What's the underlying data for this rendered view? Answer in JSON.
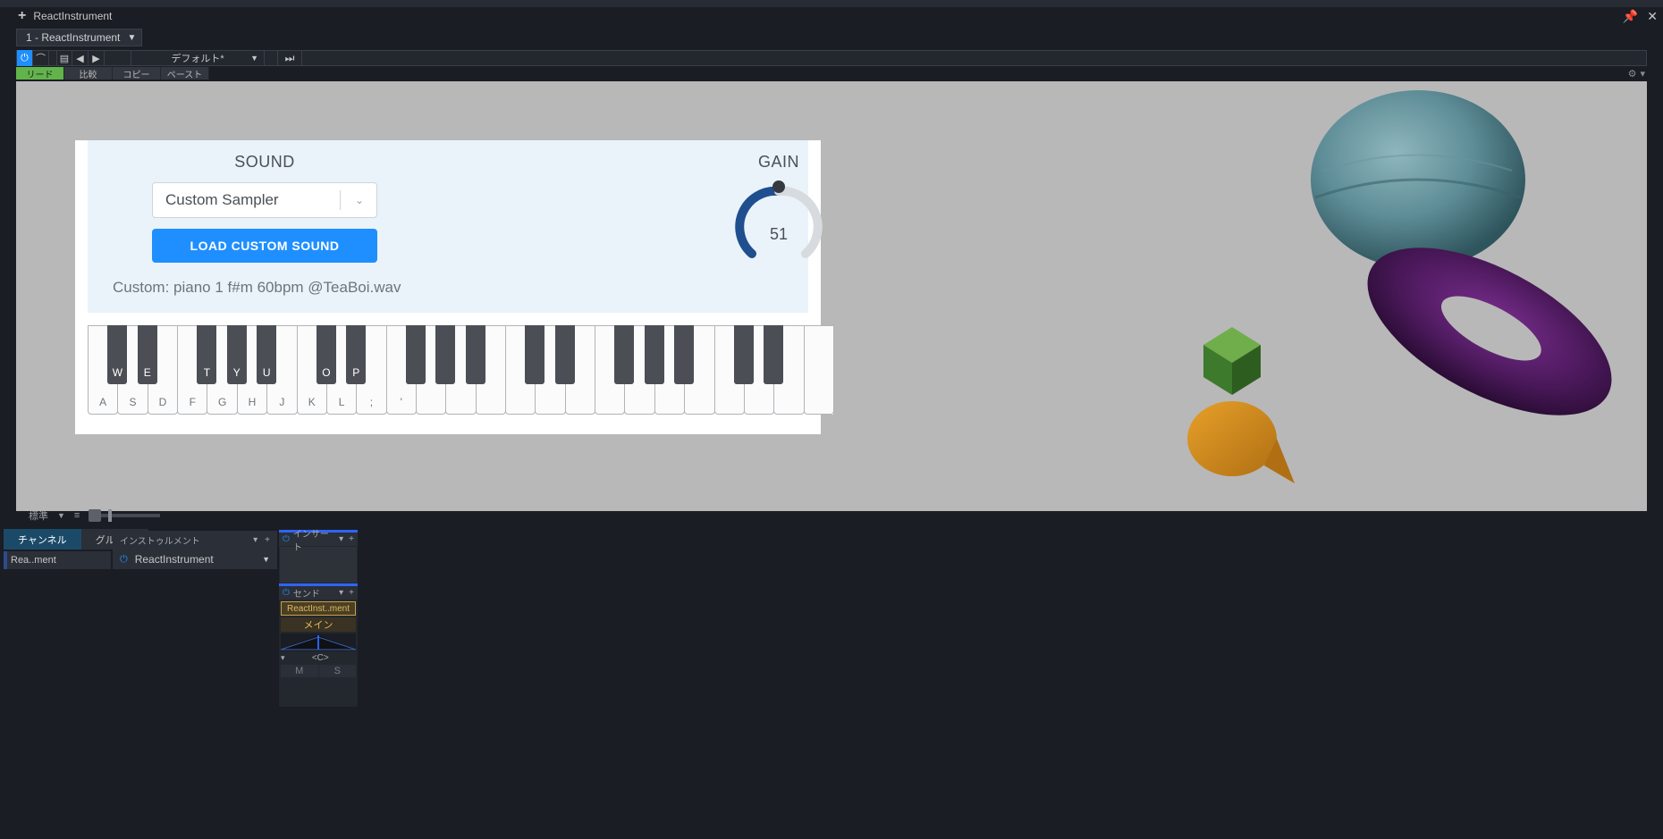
{
  "tab_title": "ReactInstrument",
  "track_selector": "1 - ReactInstrument",
  "preset_name": "デフォルト*",
  "sub_tabs": {
    "read": "リード",
    "compare": "比較",
    "copy": "コピー",
    "paste": "ペースト"
  },
  "plugin": {
    "sound_title": "SOUND",
    "sound_select_value": "Custom Sampler",
    "load_button": "LOAD CUSTOM SOUND",
    "custom_file": "Custom: piano 1 f#m 60bpm @TeaBoi.wav",
    "gain_title": "GAIN",
    "gain_value": "51",
    "white_key_labels": [
      "A",
      "S",
      "D",
      "F",
      "G",
      "H",
      "J",
      "K",
      "L",
      ";",
      "'"
    ],
    "black_key_labels": [
      "W",
      "E",
      "",
      "T",
      "Y",
      "U",
      "",
      "O",
      "P"
    ]
  },
  "bottom_std_label": "標準",
  "mixer_tabs": {
    "channel": "チャンネル",
    "group": "グループ"
  },
  "channel_name": "Rea..ment",
  "instrument_label": "インストゥルメント",
  "instrument_name": "ReactInstrument",
  "strip": {
    "insert": "インサート",
    "send": "センド",
    "react_badge": "ReactInst..ment",
    "main_badge": "メイン",
    "c_label": "<C>",
    "m": "M",
    "s": "S"
  }
}
